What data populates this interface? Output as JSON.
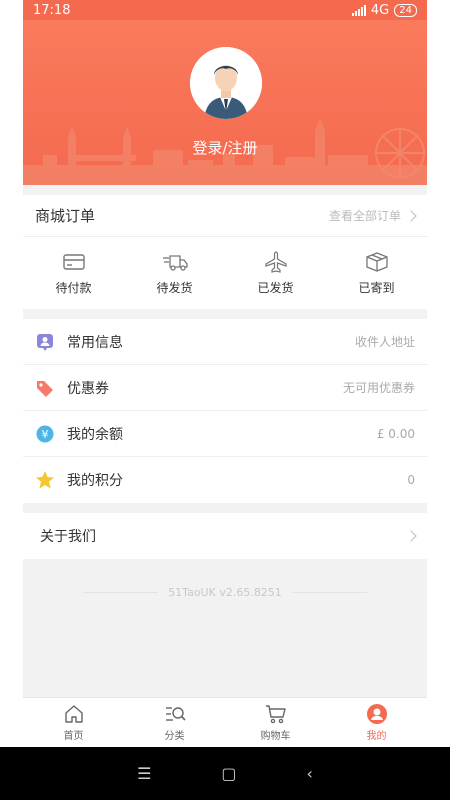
{
  "status": {
    "time": "17:18",
    "network": "4G",
    "battery": "24"
  },
  "profile": {
    "login_label": "登录/注册"
  },
  "orders": {
    "title": "商城订单",
    "view_all": "查看全部订单",
    "items": [
      {
        "label": "待付款",
        "icon": "card-icon"
      },
      {
        "label": "待发货",
        "icon": "delivery-truck-icon"
      },
      {
        "label": "已发货",
        "icon": "airplane-icon"
      },
      {
        "label": "已寄到",
        "icon": "box-icon"
      }
    ]
  },
  "info": {
    "rows": [
      {
        "label": "常用信息",
        "value": "收件人地址",
        "icon": "contact-icon",
        "color": "#8a86d8"
      },
      {
        "label": "优惠券",
        "value": "无可用优惠券",
        "icon": "tag-icon",
        "color": "#f57a6a"
      },
      {
        "label": "我的余额",
        "value": "£ 0.00",
        "icon": "yuan-icon",
        "color": "#4db6e6"
      },
      {
        "label": "我的积分",
        "value": "0",
        "icon": "star-icon",
        "color": "#f7c531"
      }
    ]
  },
  "about": {
    "label": "关于我们"
  },
  "version": {
    "text": "51TaoUK v2.65.8251"
  },
  "tabs": [
    {
      "label": "首页",
      "icon": "home-icon"
    },
    {
      "label": "分类",
      "icon": "category-search-icon"
    },
    {
      "label": "购物车",
      "icon": "cart-icon"
    },
    {
      "label": "我的",
      "icon": "user-icon",
      "active": true
    }
  ],
  "navbar": {
    "menu": "☰",
    "home": "▢",
    "back": "‹"
  },
  "colors": {
    "accent": "#f46a4f"
  }
}
